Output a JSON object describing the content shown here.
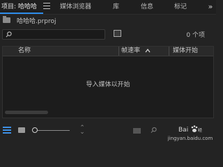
{
  "tabs": {
    "project": "项目: 哈哈哈",
    "media_browser": "媒体浏览器",
    "library": "库",
    "info": "信息",
    "markers": "标记",
    "more": "»"
  },
  "project": {
    "file_name": "哈哈哈.prproj"
  },
  "search": {
    "value": "",
    "item_count": "0 个项"
  },
  "table": {
    "columns": [
      "名称",
      "帧速率",
      "媒体开始"
    ],
    "empty_message": "导入媒体以开始"
  },
  "watermark": {
    "logo_text": "Bai 经验",
    "url": "jingyan.baidu.com"
  },
  "colors": {
    "accent": "#2d8ceb",
    "panel_bg": "#232323"
  }
}
